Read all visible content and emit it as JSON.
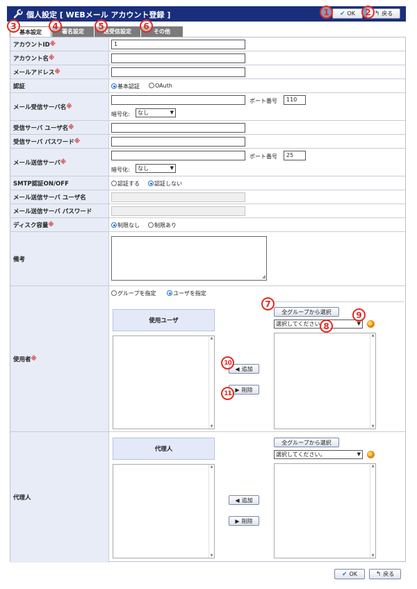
{
  "window": {
    "title": "個人設定 [ WEBメール アカウント登録 ]"
  },
  "toolbar": {
    "ok_label": "OK",
    "back_label": "戻る"
  },
  "tabs": [
    {
      "label": "基本設定",
      "active": true
    },
    {
      "label": "署名設定",
      "active": false
    },
    {
      "label": "送受信設定",
      "active": false
    },
    {
      "label": "その他",
      "active": false
    }
  ],
  "required_mark": "※",
  "fields": {
    "account_id": {
      "label": "アカウントID",
      "value": "1"
    },
    "account_name": {
      "label": "アカウント名",
      "value": ""
    },
    "mail_address": {
      "label": "メールアドレス",
      "value": ""
    },
    "auth": {
      "label": "認証",
      "options": [
        "基本認証",
        "OAuth"
      ],
      "selected": "基本認証"
    },
    "recv_server": {
      "label": "メール受信サーバ名",
      "value": "",
      "port_label": "ポート番号",
      "port_value": "110",
      "enc_label": "暗号化:",
      "enc_value": "なし"
    },
    "recv_user": {
      "label": "受信サーバ ユーザ名",
      "value": ""
    },
    "recv_pass": {
      "label": "受信サーバ パスワード",
      "value": ""
    },
    "send_server": {
      "label": "メール送信サーバ",
      "value": "",
      "port_label": "ポート番号",
      "port_value": "25",
      "enc_label": "暗号化:",
      "enc_value": "なし"
    },
    "smtp_auth": {
      "label": "SMTP認証ON/OFF",
      "options": [
        "認証する",
        "認証しない"
      ],
      "selected": "認証しない"
    },
    "send_user": {
      "label": "メール送信サーバ ユーザ名",
      "value": ""
    },
    "send_pass": {
      "label": "メール送信サーバ パスワード",
      "value": ""
    },
    "disk": {
      "label": "ディスク容量",
      "options": [
        "制限なし",
        "制限あり"
      ],
      "selected": "制限なし"
    },
    "memo": {
      "label": "備考",
      "value": ""
    }
  },
  "users": {
    "label": "使用者",
    "mode_options": [
      "グループを指定",
      "ユーザを指定"
    ],
    "mode_selected": "ユーザを指定",
    "list_header": "使用ユーザ",
    "all_groups_button": "全グループから選択",
    "group_select": "選択してください。",
    "add_button": "追加",
    "remove_button": "削除"
  },
  "proxy": {
    "label": "代理人",
    "list_header": "代理人",
    "all_groups_button": "全グループから選択",
    "group_select": "選択してください。",
    "add_button": "追加",
    "remove_button": "削除"
  },
  "annotations": [
    "1",
    "2",
    "3",
    "4",
    "5",
    "6",
    "7",
    "8",
    "9",
    "10",
    "11"
  ],
  "colors": {
    "titlebar": "#1a2f7c",
    "label_bg": "#e8ecf7",
    "required": "#d0312d",
    "marker": "#e32a20"
  }
}
